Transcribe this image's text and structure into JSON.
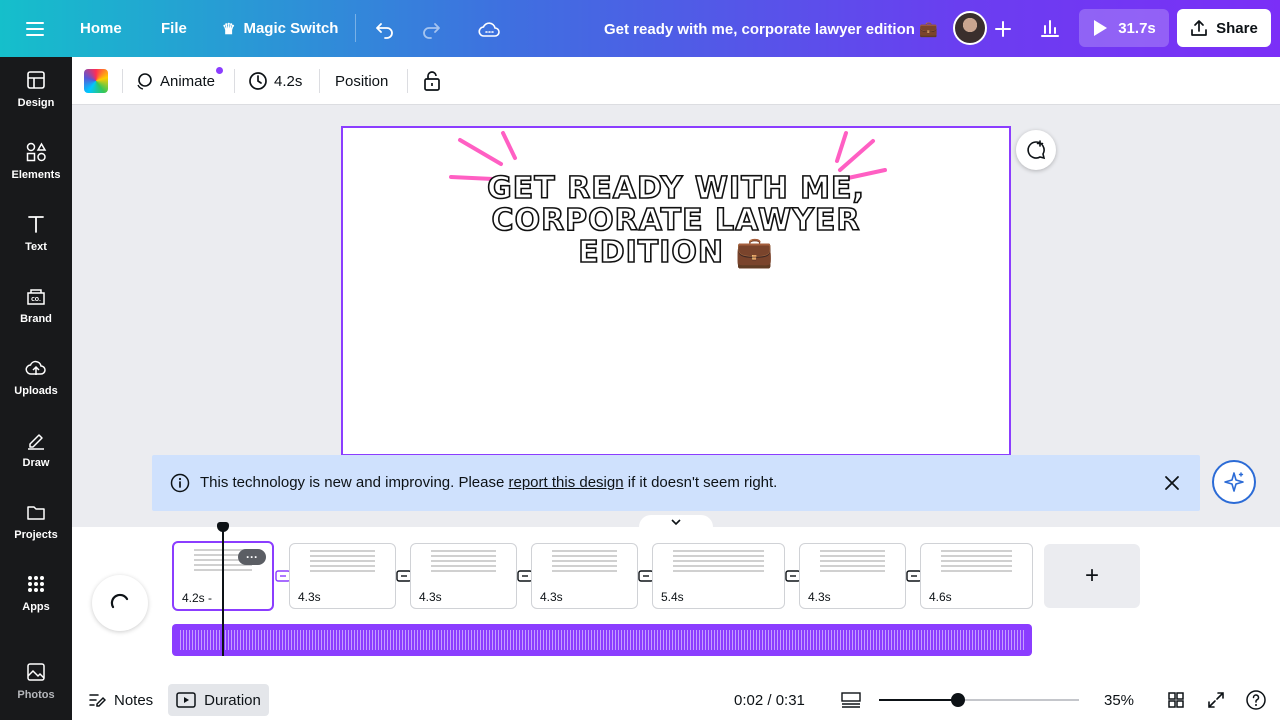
{
  "header": {
    "home": "Home",
    "file": "File",
    "magic_switch": "Magic Switch",
    "design_title": "Get ready with me, corporate lawyer edition 💼",
    "play_duration": "31.7s",
    "share": "Share"
  },
  "sidebar": {
    "items": [
      {
        "label": "Design",
        "icon": "design-icon"
      },
      {
        "label": "Elements",
        "icon": "elements-icon"
      },
      {
        "label": "Text",
        "icon": "text-icon"
      },
      {
        "label": "Brand",
        "icon": "brand-icon"
      },
      {
        "label": "Uploads",
        "icon": "uploads-icon"
      },
      {
        "label": "Draw",
        "icon": "draw-icon"
      },
      {
        "label": "Projects",
        "icon": "projects-icon"
      },
      {
        "label": "Apps",
        "icon": "apps-icon"
      },
      {
        "label": "Photos",
        "icon": "photos-icon"
      }
    ]
  },
  "toolbar": {
    "animate": "Animate",
    "duration": "4.2s",
    "position": "Position"
  },
  "canvas": {
    "title_line1": "GET READY WITH ME,",
    "title_line2": "CORPORATE LAWYER",
    "title_line3": "EDITION 💼",
    "accent_color": "#ff5fc3"
  },
  "notice": {
    "text_before": "This technology is new and improving. Please ",
    "link": "report this design",
    "text_after": " if it doesn't seem right."
  },
  "timeline": {
    "clips": [
      {
        "duration": "4.2s -",
        "active": true
      },
      {
        "duration": "4.3s"
      },
      {
        "duration": "4.3s"
      },
      {
        "duration": "4.3s"
      },
      {
        "duration": "5.4s"
      },
      {
        "duration": "4.3s"
      },
      {
        "duration": "4.6s"
      }
    ],
    "clip_menu": "···",
    "add_symbol": "+"
  },
  "footer": {
    "notes": "Notes",
    "duration": "Duration",
    "time": "0:02 / 0:31",
    "zoom": "35%",
    "zoom_level": 0.35
  },
  "colors": {
    "brand_purple": "#8b3dff",
    "sidebar_bg": "#18191b",
    "notice_bg": "#cfe1fd"
  }
}
